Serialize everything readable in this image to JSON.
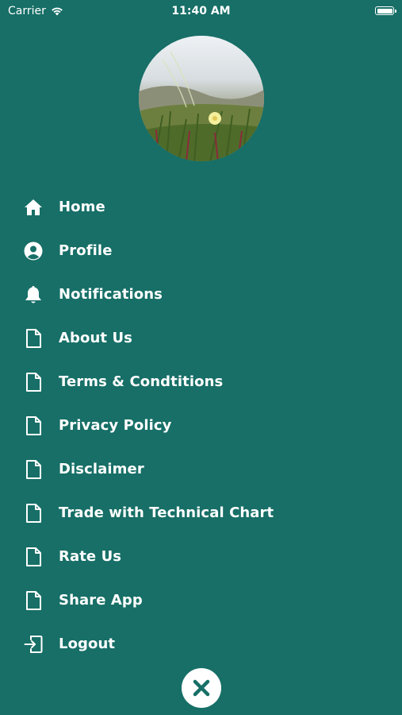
{
  "status_bar": {
    "carrier": "Carrier",
    "time": "11:40 AM"
  },
  "colors": {
    "background": "#176f67",
    "text": "#ffffff"
  },
  "menu": {
    "items": [
      {
        "label": "Home",
        "icon": "home-icon"
      },
      {
        "label": "Profile",
        "icon": "profile-icon"
      },
      {
        "label": "Notifications",
        "icon": "bell-icon"
      },
      {
        "label": "About Us",
        "icon": "document-icon"
      },
      {
        "label": "Terms & Condtitions",
        "icon": "document-icon"
      },
      {
        "label": "Privacy Policy",
        "icon": "document-icon"
      },
      {
        "label": "Disclaimer",
        "icon": "document-icon"
      },
      {
        "label": "Trade with Technical Chart",
        "icon": "document-icon"
      },
      {
        "label": "Rate Us",
        "icon": "document-icon"
      },
      {
        "label": "Share App",
        "icon": "document-icon"
      },
      {
        "label": "Logout",
        "icon": "logout-icon"
      }
    ]
  },
  "close_button": {
    "icon": "close-icon"
  }
}
